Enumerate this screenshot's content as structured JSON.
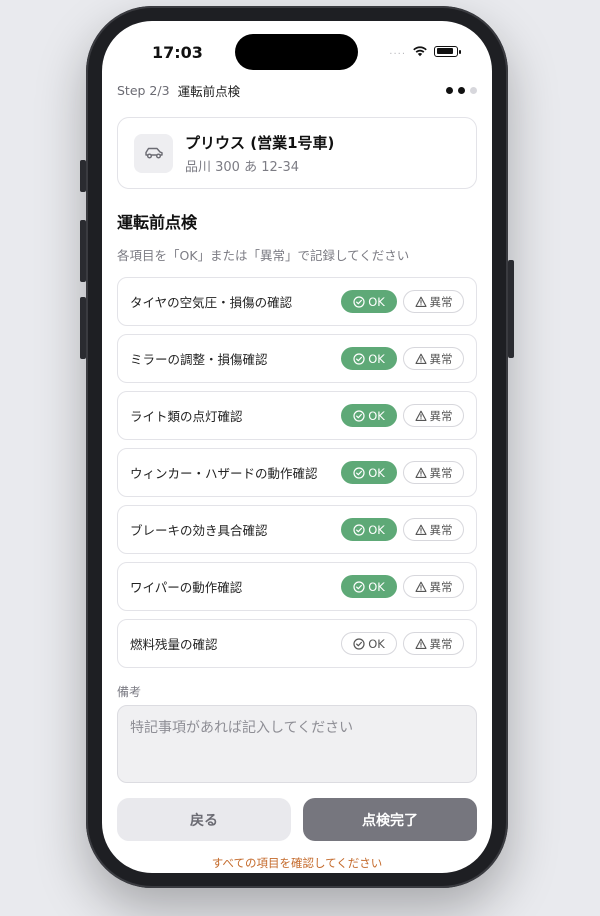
{
  "status": {
    "time": "17:03",
    "signal": "....",
    "wifi_icon": "wifi-icon",
    "battery_icon": "battery-icon"
  },
  "step": {
    "count": "Step 2/3",
    "title": "運転前点検",
    "dots_total": 3,
    "dots_active": 2
  },
  "vehicle": {
    "icon": "car-icon",
    "name": "プリウス (営業1号車)",
    "plate": "品川 300 あ 12-34"
  },
  "section": {
    "title": "運転前点検",
    "subtitle": "各項目を「OK」または「異常」で記録してください"
  },
  "buttons": {
    "ok_label": "OK",
    "ng_label": "異常",
    "ok_icon": "check-circle-icon",
    "ng_icon": "warning-triangle-icon"
  },
  "items": [
    {
      "label": "タイヤの空気圧・損傷の確認",
      "status": "ok"
    },
    {
      "label": "ミラーの調整・損傷確認",
      "status": "ok"
    },
    {
      "label": "ライト類の点灯確認",
      "status": "ok"
    },
    {
      "label": "ウィンカー・ハザードの動作確認",
      "status": "ok"
    },
    {
      "label": "ブレーキの効き具合確認",
      "status": "ok"
    },
    {
      "label": "ワイパーの動作確認",
      "status": "ok"
    },
    {
      "label": "燃料残量の確認",
      "status": "none"
    }
  ],
  "memo": {
    "label": "備考",
    "placeholder": "特記事項があれば記入してください"
  },
  "footer": {
    "back_label": "戻る",
    "done_label": "点検完了",
    "warning": "すべての項目を確認してください"
  },
  "colors": {
    "ok_green": "#5ea977",
    "warning_orange": "#c46a2b",
    "done_disabled": "#76767e"
  }
}
